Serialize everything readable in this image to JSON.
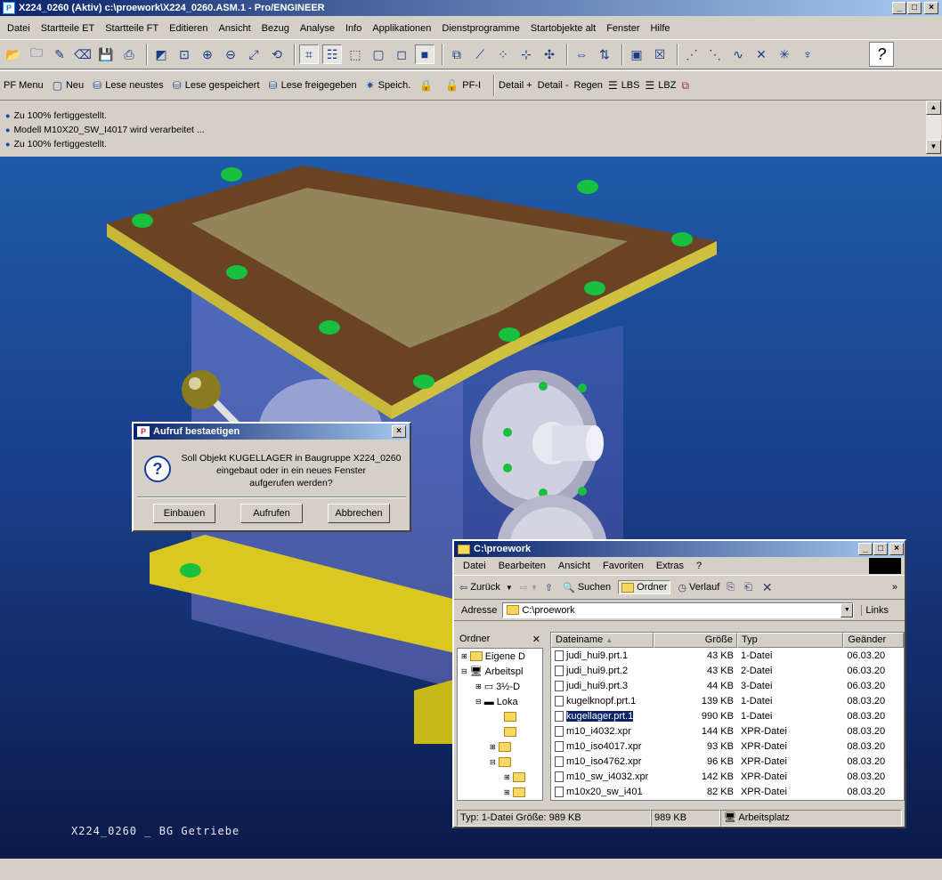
{
  "window": {
    "title": "X224_0260 (Aktiv)  c:\\proework\\X224_0260.ASM.1 - Pro/ENGINEER"
  },
  "menu": [
    "Datei",
    "Startteile ET",
    "Startteile FT",
    "Editieren",
    "Ansicht",
    "Bezug",
    "Analyse",
    "Info",
    "Applikationen",
    "Dienstprogramme",
    "Startobjekte alt",
    "Fenster",
    "Hilfe"
  ],
  "toolbar2": {
    "pf_menu": "PF Menu",
    "neu": "Neu",
    "lese_neustes": "Lese neustes",
    "lese_gespeichert": "Lese gespeichert",
    "lese_freigegeben": "Lese freigegeben",
    "speich": "Speich.",
    "pfi": "PF-I",
    "detail_plus": "Detail +",
    "detail_minus": "Detail -",
    "regen": "Regen",
    "lbs": "LBS",
    "lbz": "LBZ"
  },
  "messages": [
    "Zu 100% fertiggestellt.",
    "Modell M10X20_SW_I4017 wird verarbeitet ...",
    "Zu 100% fertiggestellt."
  ],
  "viewport": {
    "label": "X224_0260 _ BG Getriebe"
  },
  "dialog": {
    "title": "Aufruf bestaetigen",
    "line1": "Soll Objekt KUGELLAGER in Baugruppe X224_0260",
    "line2": "eingebaut oder in ein neues Fenster",
    "line3": "aufgerufen werden?",
    "btn_einbauen": "Einbauen",
    "btn_aufrufen": "Aufrufen",
    "btn_abbrechen": "Abbrechen"
  },
  "explorer": {
    "title": "C:\\proework",
    "menu": [
      "Datei",
      "Bearbeiten",
      "Ansicht",
      "Favoriten",
      "Extras",
      "?"
    ],
    "toolbar": {
      "back": "Zurück",
      "search": "Suchen",
      "folders": "Ordner",
      "history": "Verlauf"
    },
    "address_label": "Adresse",
    "address_value": "C:\\proework",
    "links": "Links",
    "folder_pane_title": "Ordner",
    "tree": [
      "Eigene D",
      "Arbeitspl",
      "3½-D",
      "Loka",
      "",
      "",
      "",
      "",
      "",
      ""
    ],
    "columns": [
      "Dateiname",
      "Größe",
      "Typ",
      "Geänder"
    ],
    "files": [
      {
        "name": "judi_hui9.prt.1",
        "size": "43 KB",
        "type": "1-Datei",
        "date": "06.03.20"
      },
      {
        "name": "judi_hui9.prt.2",
        "size": "43 KB",
        "type": "2-Datei",
        "date": "06.03.20"
      },
      {
        "name": "judi_hui9.prt.3",
        "size": "44 KB",
        "type": "3-Datei",
        "date": "06.03.20"
      },
      {
        "name": "kugelknopf.prt.1",
        "size": "139 KB",
        "type": "1-Datei",
        "date": "08.03.20"
      },
      {
        "name": "kugellager.prt.1",
        "size": "990 KB",
        "type": "1-Datei",
        "date": "08.03.20"
      },
      {
        "name": "m10_i4032.xpr",
        "size": "144 KB",
        "type": "XPR-Datei",
        "date": "08.03.20"
      },
      {
        "name": "m10_iso4017.xpr",
        "size": "93 KB",
        "type": "XPR-Datei",
        "date": "08.03.20"
      },
      {
        "name": "m10_iso4762.xpr",
        "size": "96 KB",
        "type": "XPR-Datei",
        "date": "08.03.20"
      },
      {
        "name": "m10_sw_i4032.xpr",
        "size": "142 KB",
        "type": "XPR-Datei",
        "date": "08.03.20"
      },
      {
        "name": "m10x20_sw_i401",
        "size": "82 KB",
        "type": "XPR-Datei",
        "date": "08.03.20"
      }
    ],
    "selected_index": 4,
    "status": {
      "info": "Typ: 1-Datei Größe: 989 KB",
      "size": "989 KB",
      "zone": "Arbeitsplatz"
    }
  }
}
